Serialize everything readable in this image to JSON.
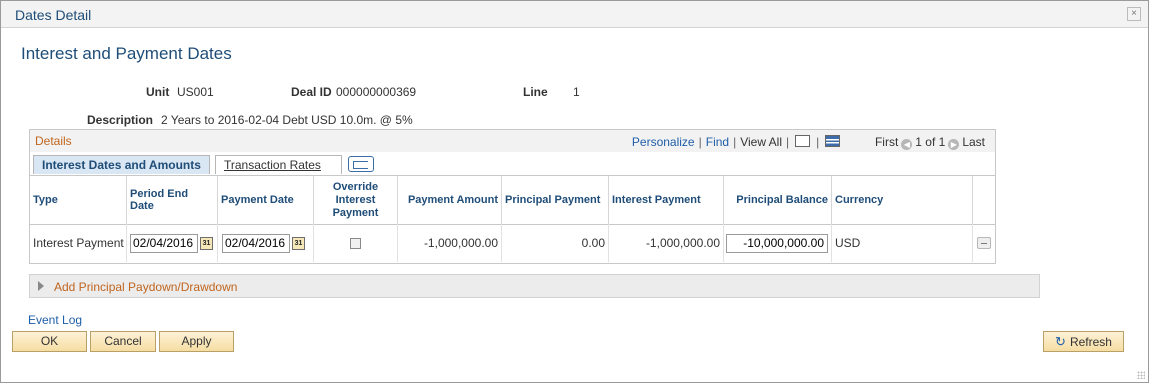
{
  "window": {
    "title": "Dates Detail",
    "close_glyph": "×"
  },
  "page": {
    "title": "Interest and Payment Dates"
  },
  "fields": {
    "unit_label": "Unit",
    "unit_value": "US001",
    "deal_label": "Deal ID",
    "deal_value": "000000000369",
    "line_label": "Line",
    "line_value": "1",
    "description_label": "Description",
    "description_value": "2 Years to 2016-02-04 Debt USD 10.0m. @ 5%"
  },
  "details": {
    "title": "Details",
    "nav": {
      "personalize": "Personalize",
      "find": "Find",
      "view_all": "View All",
      "first": "First",
      "count": "1 of 1",
      "last": "Last"
    },
    "tabs": [
      "Interest Dates and Amounts",
      "Transaction Rates"
    ],
    "columns": {
      "type": "Type",
      "period_end": "Period End Date",
      "payment_date": "Payment Date",
      "override": "Override Interest Payment",
      "payment_amount": "Payment Amount",
      "principal_payment": "Principal Payment",
      "interest_payment": "Interest Payment",
      "principal_balance": "Principal Balance",
      "currency": "Currency"
    },
    "rows": [
      {
        "type": "Interest Payment",
        "period_end": "02/04/2016",
        "payment_date": "02/04/2016",
        "override_checked": false,
        "payment_amount": "-1,000,000.00",
        "principal_payment": "0.00",
        "interest_payment": "-1,000,000.00",
        "principal_balance": "-10,000,000.00",
        "currency": "USD"
      }
    ]
  },
  "section": {
    "collapsed_label": "Add Principal Paydown/Drawdown"
  },
  "footer": {
    "event_log": "Event Log",
    "ok": "OK",
    "cancel": "Cancel",
    "apply": "Apply",
    "refresh": "Refresh"
  },
  "colors": {
    "title_blue": "#1f4d78",
    "link_blue": "#1f5ea8",
    "section_orange": "#c0651e",
    "button_face": "#f6dda3"
  },
  "icons": [
    "close-icon",
    "zoom-grid-icon",
    "download-grid-icon",
    "first-arrow-icon",
    "last-arrow-icon",
    "show-all-columns-icon",
    "calendar-icon",
    "delete-row-icon",
    "expand-arrow-icon",
    "refresh-icon"
  ]
}
